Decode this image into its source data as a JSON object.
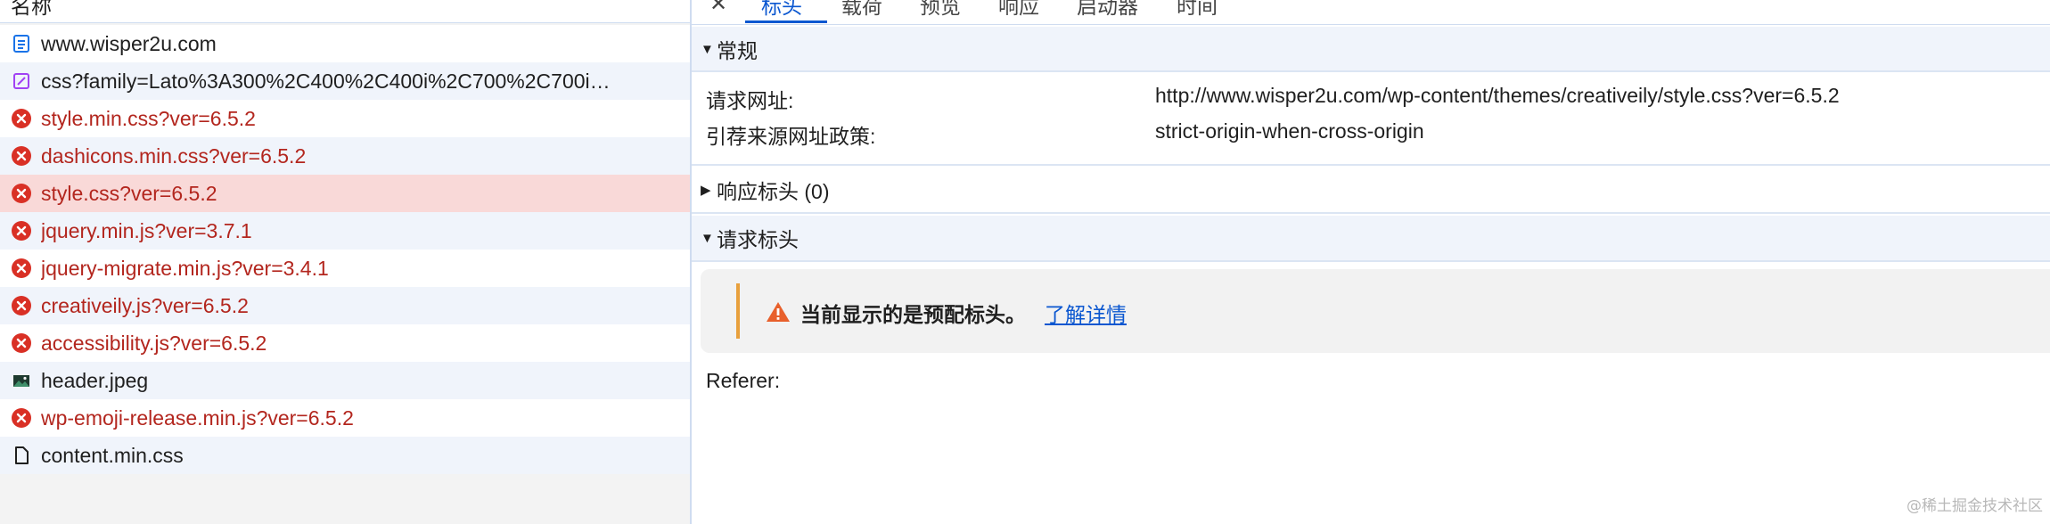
{
  "list": {
    "header": "名称",
    "rows": [
      {
        "name": "www.wisper2u.com",
        "icon": "document-icon",
        "status": "ok"
      },
      {
        "name": "css?family=Lato%3A300%2C400%2C400i%2C700%2C700i…",
        "icon": "stylesheet-icon",
        "status": "ok"
      },
      {
        "name": "style.min.css?ver=6.5.2",
        "icon": "error-icon",
        "status": "error"
      },
      {
        "name": "dashicons.min.css?ver=6.5.2",
        "icon": "error-icon",
        "status": "error"
      },
      {
        "name": "style.css?ver=6.5.2",
        "icon": "error-icon",
        "status": "error",
        "selected": true
      },
      {
        "name": "jquery.min.js?ver=3.7.1",
        "icon": "error-icon",
        "status": "error"
      },
      {
        "name": "jquery-migrate.min.js?ver=3.4.1",
        "icon": "error-icon",
        "status": "error"
      },
      {
        "name": "creativeily.js?ver=6.5.2",
        "icon": "error-icon",
        "status": "error"
      },
      {
        "name": "accessibility.js?ver=6.5.2",
        "icon": "error-icon",
        "status": "error"
      },
      {
        "name": "header.jpeg",
        "icon": "image-icon",
        "status": "ok"
      },
      {
        "name": "wp-emoji-release.min.js?ver=6.5.2",
        "icon": "error-icon",
        "status": "error"
      },
      {
        "name": "content.min.css",
        "icon": "file-icon",
        "status": "ok"
      }
    ]
  },
  "tabs": {
    "close": "✕",
    "items": [
      {
        "label": "标头",
        "active": true
      },
      {
        "label": "载荷",
        "active": false
      },
      {
        "label": "预览",
        "active": false
      },
      {
        "label": "响应",
        "active": false
      },
      {
        "label": "启动器",
        "active": false
      },
      {
        "label": "时间",
        "active": false
      }
    ]
  },
  "general": {
    "title": "常规",
    "caret": "▼",
    "request_url_label": "请求网址:",
    "request_url_value": "http://www.wisper2u.com/wp-content/themes/creativeily/style.css?ver=6.5.2",
    "referrer_policy_label": "引荐来源网址政策:",
    "referrer_policy_value": "strict-origin-when-cross-origin"
  },
  "response_headers": {
    "title": "响应标头 (0)",
    "caret": "▶"
  },
  "request_headers": {
    "title": "请求标头",
    "caret": "▼",
    "notice_text": "当前显示的是预配标头。",
    "notice_link": "了解详情",
    "referer_label": "Referer:"
  },
  "watermark": "@稀土掘金技术社区",
  "colors": {
    "error": "#b3261e",
    "accent": "#0b57d0",
    "selected_row": "#f9d9d8",
    "warning": "#e8a03c"
  }
}
